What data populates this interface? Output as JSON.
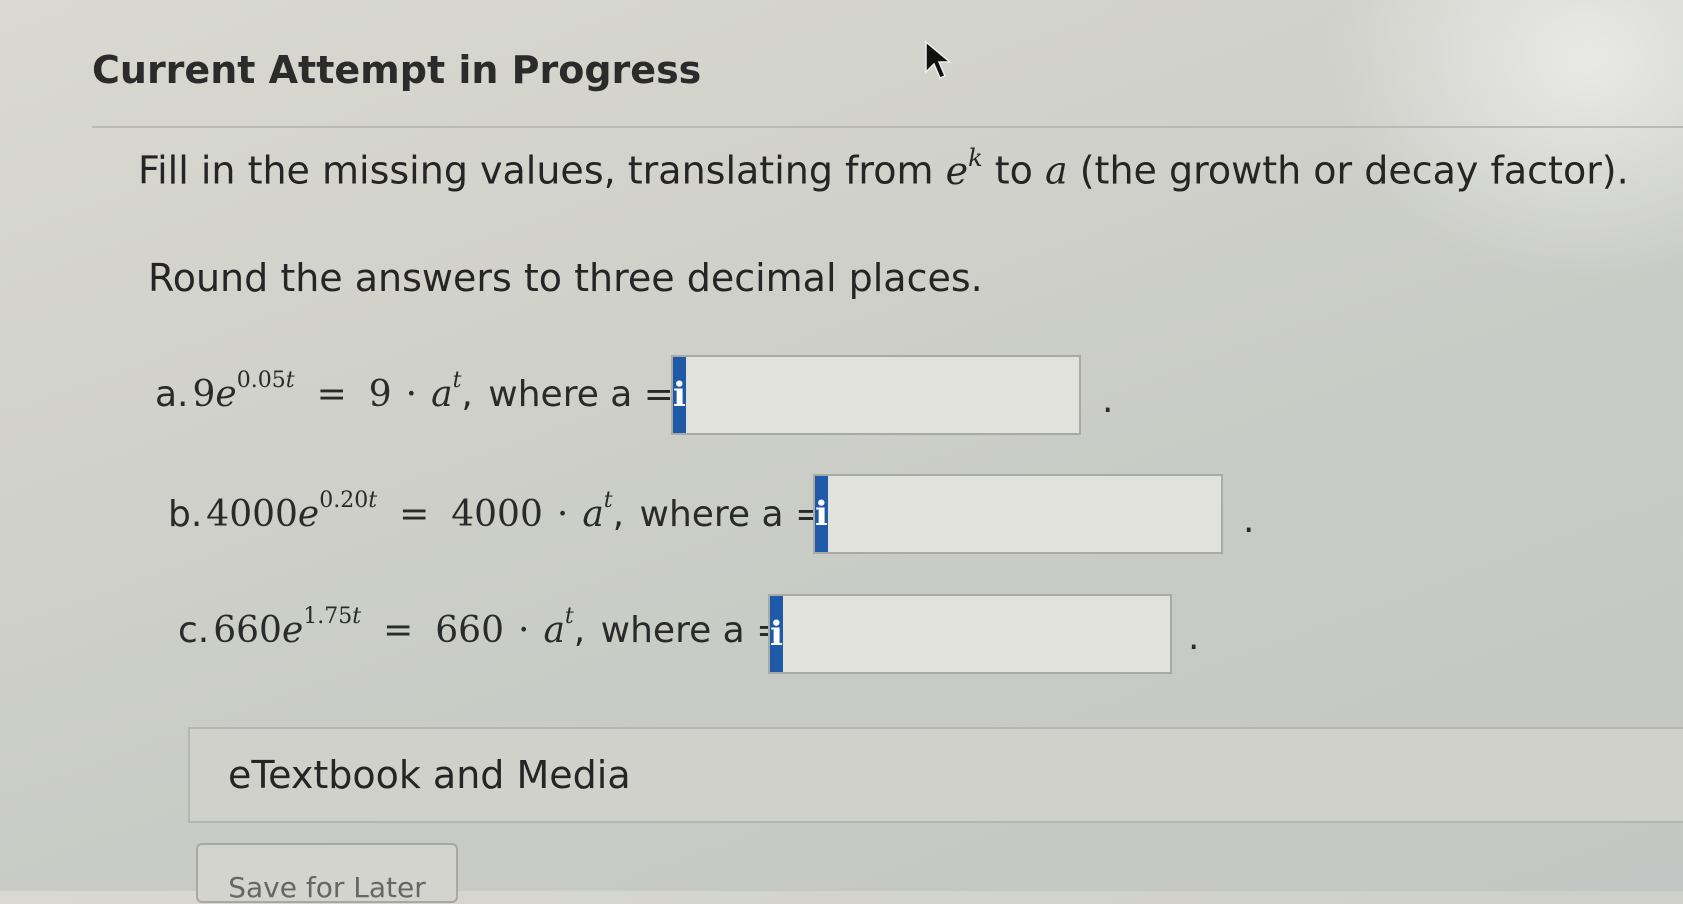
{
  "header": {
    "title": "Current Attempt in Progress"
  },
  "instructions": {
    "line1_prefix": "Fill in the missing values, translating from",
    "base": "e",
    "exp": "k",
    "to": "to",
    "var_a": "a",
    "line1_suffix": "(the growth or decay factor).",
    "line2": "Round the answers to three decimal places."
  },
  "problems": [
    {
      "label": "a.",
      "coef": "9",
      "rate": "0.05",
      "rhs_coef": "9",
      "where": "where a =",
      "value": ""
    },
    {
      "label": "b.",
      "coef": "4000",
      "rate": "0.20",
      "rhs_coef": "4000",
      "where": "where a =",
      "value": ""
    },
    {
      "label": "c.",
      "coef": "660",
      "rate": "1.75",
      "rhs_coef": "660",
      "where": "where a =",
      "value": ""
    }
  ],
  "info_icon": {
    "glyph": "i",
    "name": "info-icon",
    "color": "#1f5aa8"
  },
  "media": {
    "label": "eTextbook and Media"
  },
  "footer": {
    "save_label": "Save for Later"
  },
  "colors": {
    "accent": "#1f5aa8",
    "background": "#d2d2cb"
  }
}
